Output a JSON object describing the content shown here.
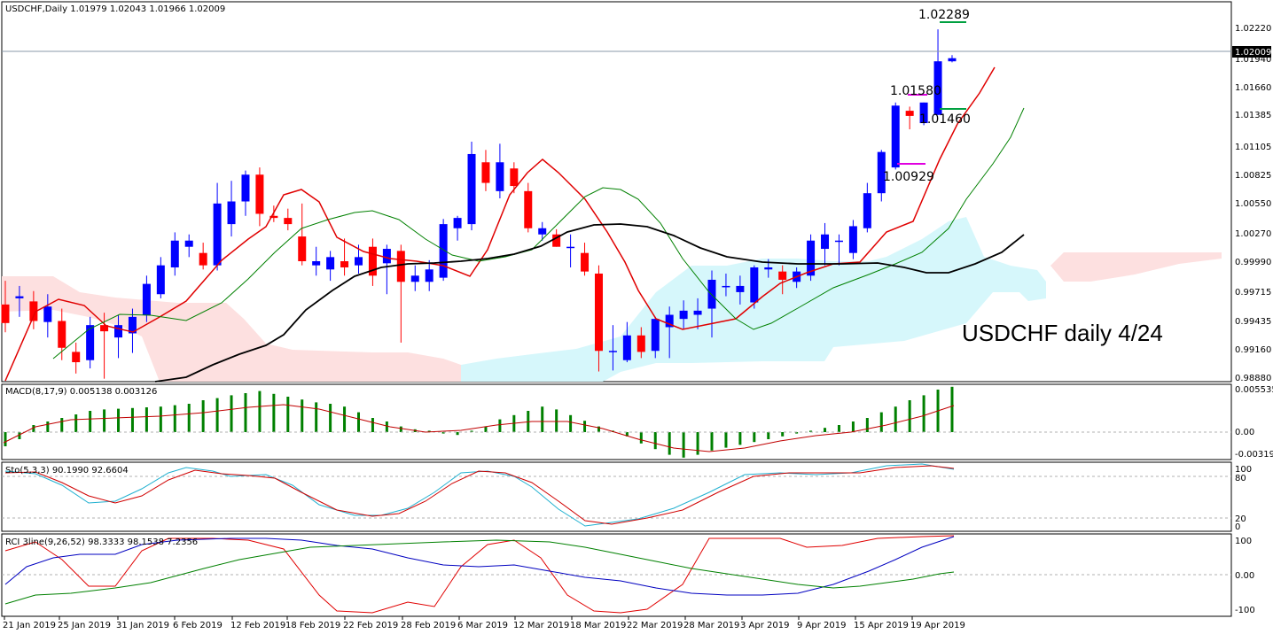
{
  "header": {
    "symbol_line": "USDCHF,Daily  1.01979 1.02043 1.01966 1.02009"
  },
  "watermark": "USDCHF daily 4/24",
  "annotations": {
    "high": "1.02289",
    "peak2": "1.01580",
    "low2": "1.01460",
    "low1": "1.00929"
  },
  "price_axis": {
    "ticks": [
      "1.02220",
      "1.01940",
      "1.01660",
      "1.01385",
      "1.01105",
      "1.00825",
      "1.00550",
      "1.00270",
      "0.99990",
      "0.99715",
      "0.99435",
      "0.99160",
      "0.98880"
    ],
    "current_price": "1.02009"
  },
  "macd": {
    "label": "MACD(8,17,9) 0.005138 0.003126",
    "ticks": [
      "0.005535",
      "0.00",
      "-0.003199"
    ]
  },
  "sto": {
    "label": "Sto(5,3,3) 90.1990 92.6604",
    "ticks": [
      "100",
      "80",
      "20",
      "0"
    ]
  },
  "rci": {
    "label": "RCI 3line(9,26,52) 98.3333 98.1538 7.2356",
    "ticks": [
      "100",
      "0.00",
      "-100"
    ]
  },
  "x_axis": [
    "21 Jan 2019",
    "25 Jan 2019",
    "31 Jan 2019",
    "6 Feb 2019",
    "12 Feb 2019",
    "18 Feb 2019",
    "22 Feb 2019",
    "28 Feb 2019",
    "6 Mar 2019",
    "12 Mar 2019",
    "18 Mar 2019",
    "22 Mar 2019",
    "28 Mar 2019",
    "3 Apr 2019",
    "9 Apr 2019",
    "15 Apr 2019",
    "19 Apr 2019"
  ],
  "colors": {
    "bull": "#0000ff",
    "bear": "#ff0000",
    "ma_fast": "#e00000",
    "ma_mid": "#008000",
    "ma_slow": "#000000",
    "cloud_bull": "#d6f7fb",
    "cloud_bear": "#fde0e0",
    "macd_hist": "#008000",
    "macd_signal": "#c00000",
    "sto_main": "#20b0d0",
    "sto_signal": "#d00000",
    "rci_short": "#e00000",
    "rci_mid": "#0000c0",
    "rci_long": "#008000"
  },
  "chart_data": {
    "type": "candlestick",
    "title": "USDCHF,Daily",
    "ylim": [
      0.9888,
      1.0236
    ],
    "candles": [
      [
        0.9962,
        0.9985,
        0.9935,
        0.9944
      ],
      [
        0.9968,
        0.998,
        0.995,
        0.997
      ],
      [
        0.9965,
        0.9975,
        0.9938,
        0.9946
      ],
      [
        0.9945,
        0.9972,
        0.993,
        0.996
      ],
      [
        0.9946,
        0.9958,
        0.9908,
        0.992
      ],
      [
        0.9916,
        0.9925,
        0.9895,
        0.9906
      ],
      [
        0.9908,
        0.995,
        0.99,
        0.9942
      ],
      [
        0.9942,
        0.9954,
        0.989,
        0.9936
      ],
      [
        0.993,
        0.9952,
        0.991,
        0.9942
      ],
      [
        0.9934,
        0.9958,
        0.9915,
        0.995
      ],
      [
        0.9952,
        0.999,
        0.9945,
        0.9982
      ],
      [
        0.9972,
        1.0008,
        0.9968,
        1.0
      ],
      [
        0.9998,
        1.0032,
        0.999,
        1.0024
      ],
      [
        1.0018,
        1.003,
        1.0008,
        1.0024
      ],
      [
        1.0012,
        1.0022,
        0.9996,
        1.0
      ],
      [
        1.0,
        1.008,
        0.9995,
        1.006
      ],
      [
        1.004,
        1.0082,
        1.0028,
        1.0062
      ],
      [
        1.0062,
        1.0092,
        1.0048,
        1.0088
      ],
      [
        1.0088,
        1.0095,
        1.0038,
        1.005
      ],
      [
        1.0048,
        1.0058,
        1.0042,
        1.0046
      ],
      [
        1.0046,
        1.0055,
        1.0034,
        1.004
      ],
      [
        1.0028,
        1.006,
        1.0,
        1.0004
      ],
      [
        1.0,
        1.0018,
        0.999,
        1.0004
      ],
      [
        0.9996,
        1.0014,
        0.9985,
        1.0008
      ],
      [
        1.0004,
        1.0026,
        0.999,
        0.9998
      ],
      [
        1.0,
        1.002,
        0.9992,
        1.0008
      ],
      [
        1.0018,
        1.0026,
        0.998,
        0.999
      ],
      [
        1.0002,
        1.002,
        0.9972,
        1.0016
      ],
      [
        1.0014,
        1.002,
        0.9925,
        0.9984
      ],
      [
        0.9984,
        1.0,
        0.9975,
        0.999
      ],
      [
        0.9984,
        1.0005,
        0.9975,
        0.9996
      ],
      [
        0.9988,
        1.0045,
        0.9985,
        1.004
      ],
      [
        1.0036,
        1.0048,
        1.0024,
        1.0046
      ],
      [
        1.004,
        1.012,
        1.0034,
        1.0108
      ],
      [
        1.01,
        1.0112,
        1.0072,
        1.008
      ],
      [
        1.0072,
        1.0118,
        1.0065,
        1.01
      ],
      [
        1.0094,
        1.01,
        1.007,
        1.0077
      ],
      [
        1.0072,
        1.008,
        1.0032,
        1.0036
      ],
      [
        1.003,
        1.0042,
        1.0024,
        1.0036
      ],
      [
        1.003,
        1.0035,
        1.0018,
        1.0018
      ],
      [
        1.0018,
        1.003,
        0.9998,
        1.0018
      ],
      [
        1.0012,
        1.0022,
        0.999,
        0.9994
      ],
      [
        0.9992,
        1.0,
        0.9897,
        0.9917
      ],
      [
        0.9917,
        0.9942,
        0.9898,
        0.9917
      ],
      [
        0.9908,
        0.9945,
        0.9906,
        0.9932
      ],
      [
        0.9932,
        0.994,
        0.991,
        0.9916
      ],
      [
        0.9917,
        0.995,
        0.991,
        0.9948
      ],
      [
        0.994,
        0.996,
        0.991,
        0.9952
      ],
      [
        0.9948,
        0.9966,
        0.9938,
        0.9956
      ],
      [
        0.9952,
        0.9968,
        0.9938,
        0.9956
      ],
      [
        0.9958,
        0.9995,
        0.993,
        0.9986
      ],
      [
        0.998,
        0.9992,
        0.997,
        0.998
      ],
      [
        0.9974,
        0.999,
        0.9962,
        0.998
      ],
      [
        0.9964,
        1.0,
        0.9958,
        0.9998
      ],
      [
        0.9996,
        1.0006,
        0.9988,
        0.9998
      ],
      [
        0.9994,
        1.0,
        0.9972,
        0.9986
      ],
      [
        0.9984,
        0.9998,
        0.9978,
        0.9994
      ],
      [
        0.999,
        1.003,
        0.9985,
        1.0024
      ],
      [
        1.0016,
        1.0041,
        1.0,
        1.003
      ],
      [
        1.0024,
        1.003,
        1.0,
        1.0024
      ],
      [
        1.0012,
        1.0044,
        1.0006,
        1.0038
      ],
      [
        1.0036,
        1.008,
        1.0032,
        1.007
      ],
      [
        1.007,
        1.0112,
        1.0062,
        1.011
      ],
      [
        1.0095,
        1.0158,
        1.0093,
        1.0155
      ],
      [
        1.015,
        1.0154,
        1.0132,
        1.0145
      ],
      [
        1.0138,
        1.0158,
        1.0136,
        1.0158
      ],
      [
        1.0146,
        1.0229,
        1.0146,
        1.0198
      ],
      [
        1.0198,
        1.0204,
        1.0197,
        1.0201
      ]
    ]
  }
}
